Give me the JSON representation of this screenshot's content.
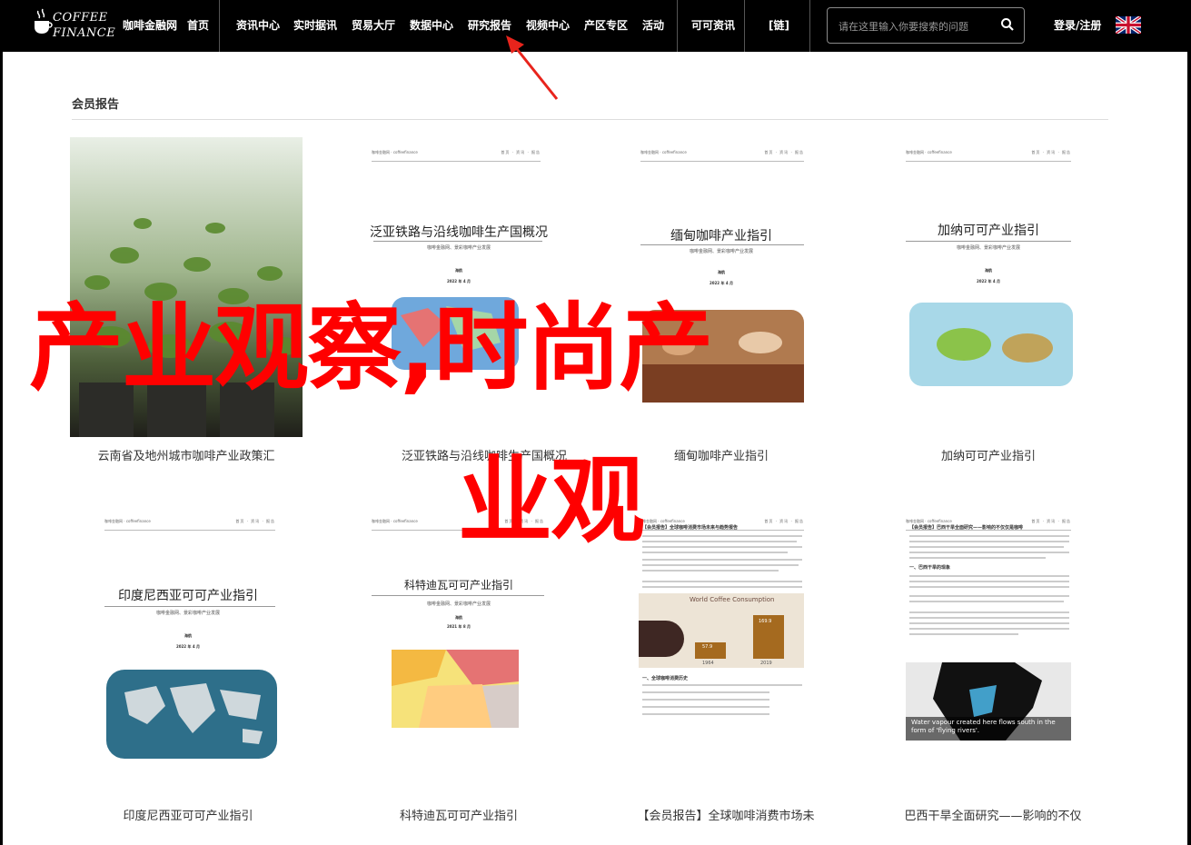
{
  "header": {
    "logo_line1": "COFFEE",
    "logo_line2": "FINANCE",
    "brand_link": "咖啡金融网",
    "nav": [
      "首页",
      "资讯中心",
      "实时据讯",
      "贸易大厅",
      "数据中心",
      "研究报告",
      "视频中心",
      "产区专区",
      "活动",
      "可可资讯",
      "[链]"
    ],
    "search_placeholder": "请在这里输入你要搜索的问题",
    "login": "登录/注册"
  },
  "section_title": "会员报告",
  "cards": [
    {
      "caption": "云南省及地州城市咖啡产业政策汇"
    },
    {
      "caption": "泛亚铁路与沿线咖啡生产国概况",
      "doc_title": "泛亚铁路与沿线咖啡生产国概况",
      "doc_sub": "咖啡金融网、景彩咖啡产业发展",
      "doc_org": "海航",
      "doc_date": "2022 年 4 月"
    },
    {
      "caption": "缅甸咖啡产业指引",
      "doc_title": "缅甸咖啡产业指引",
      "doc_sub": "咖啡金融网、景彩咖啡产业发展",
      "doc_org": "海航",
      "doc_date": "2022 年 4 月"
    },
    {
      "caption": "加纳可可产业指引",
      "doc_title": "加纳可可产业指引",
      "doc_sub": "咖啡金融网、景彩咖啡产业发展",
      "doc_org": "海航",
      "doc_date": "2022 年 4 月"
    },
    {
      "caption": "印度尼西亚可可产业指引",
      "doc_title": "印度尼西亚可可产业指引",
      "doc_sub": "咖啡金融网、景彩咖啡产业发展",
      "doc_org": "海航",
      "doc_date": "2022 年 4 月"
    },
    {
      "caption": "科特迪瓦可可产业指引",
      "doc_title": "科特迪瓦可可产业指引",
      "doc_sub": "咖啡金融网、景彩咖啡产业发展",
      "doc_org": "海航",
      "doc_date": "2021 年 8 月"
    },
    {
      "caption": "【会员报告】全球咖啡消费市场未",
      "doc_title": "【会员报告】全球咖啡消费市场未来与趋势报告",
      "chart_title": "World Coffee Consumption",
      "chart_values": [
        {
          "year": "1964",
          "value": "57.9"
        },
        {
          "year": "2019",
          "value": "169.9"
        }
      ],
      "section_heading": "一、全球咖啡消费历史"
    },
    {
      "caption": "巴西干旱全面研究——影响的不仅",
      "doc_title": "【会员报告】巴西干旱全面研究——影响的不仅仅是咖啡",
      "map_caption": "Water vapour created here flows south in the form of 'flying rivers'.",
      "section_heading": "一、巴西干旱的现象"
    }
  ],
  "overlay": {
    "line1": "产业观察,时尚产",
    "line2": "业观"
  }
}
